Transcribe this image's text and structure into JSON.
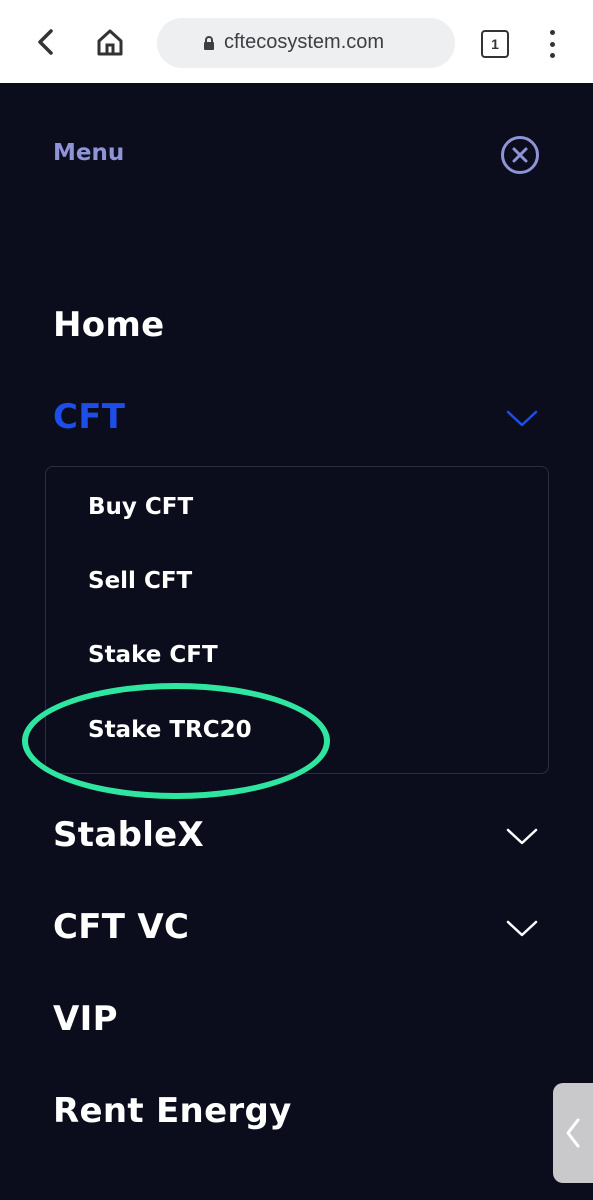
{
  "browser": {
    "url": "cftecosystem.com",
    "tab_count": "1",
    "icons": {
      "back": "arrow-left-icon",
      "home": "home-icon",
      "lock": "lock-icon",
      "menu": "kebab-menu-icon"
    }
  },
  "menu": {
    "title": "Menu",
    "close_icon": "close-circle-icon",
    "items": [
      {
        "label": "Home",
        "expandable": false
      },
      {
        "label": "CFT",
        "expandable": true,
        "expanded": true
      },
      {
        "label": "StableX",
        "expandable": true,
        "expanded": false
      },
      {
        "label": "CFT VC",
        "expandable": true,
        "expanded": false
      },
      {
        "label": "VIP",
        "expandable": false
      },
      {
        "label": "Rent Energy",
        "expandable": false
      }
    ],
    "cft_submenu": [
      "Buy CFT",
      "Sell CFT",
      "Stake CFT",
      "Stake TRC20"
    ],
    "highlighted_item": "Stake TRC20"
  },
  "colors": {
    "background": "#0b0d1c",
    "menu_title": "#8f94d6",
    "active": "#1d4eea",
    "highlight": "#2fe6a1"
  },
  "side_tab_icon": "chevron-left-icon"
}
